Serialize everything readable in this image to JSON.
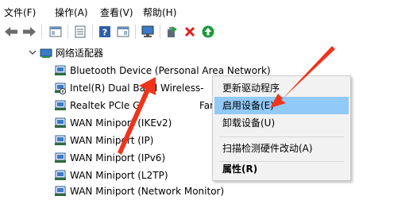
{
  "menubar": {
    "items": [
      {
        "label": "文件(F)"
      },
      {
        "label": "操作(A)"
      },
      {
        "label": "查看(V)"
      },
      {
        "label": "帮助(H)"
      }
    ]
  },
  "toolbar": {
    "icons": [
      "back-arrow-icon",
      "forward-arrow-icon",
      "properties-icon",
      "list-icon",
      "help-icon",
      "view-icon",
      "monitor-icon",
      "update-driver-icon",
      "uninstall-x-icon",
      "enable-device-icon"
    ],
    "colors": {
      "uninstall": "#e02020",
      "enable": "#1a9a3a"
    }
  },
  "tree": {
    "root": {
      "label": "网络适配器"
    },
    "items": [
      {
        "label": "Bluetooth Device (Personal Area Network)"
      },
      {
        "label": "Intel(R) Dual Band Wireless-"
      },
      {
        "label": "Realtek PCIe G"
      },
      {
        "label": "Family Co"
      },
      {
        "label": "WAN Miniport (IKEv2)"
      },
      {
        "label": "WAN Miniport (IP)"
      },
      {
        "label": "WAN Miniport (IPv6)"
      },
      {
        "label": "WAN Miniport (L2TP)"
      },
      {
        "label": "WAN Miniport (Network Monitor)"
      }
    ]
  },
  "context_menu": {
    "items": [
      {
        "label": "更新驱动程序"
      },
      {
        "label": "启用设备(E)"
      },
      {
        "label": "卸载设备(U)"
      },
      {
        "label": "扫描检测硬件改动(A)"
      },
      {
        "label": "属性(R)"
      }
    ],
    "highlight_color": "#91c9f7"
  },
  "annotation": {
    "arrow_color": "#f0341c"
  }
}
